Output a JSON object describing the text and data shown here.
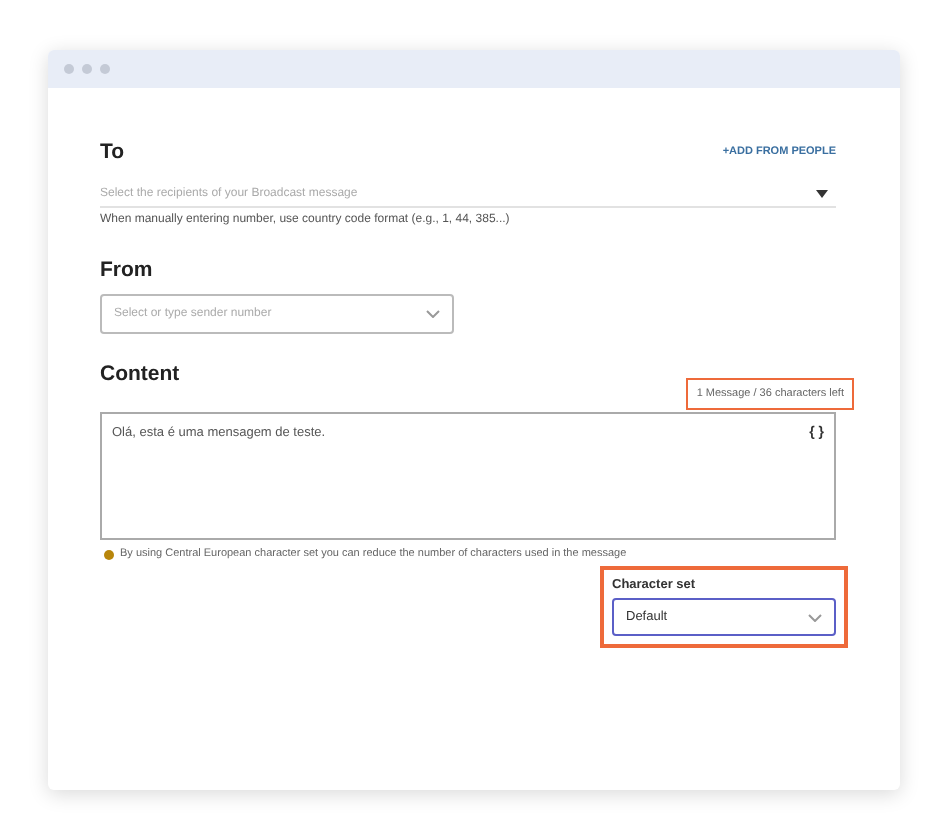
{
  "to": {
    "label": "To",
    "action": "+ADD FROM PEOPLE",
    "placeholder": "Select the recipients of your Broadcast message",
    "hint": "When manually entering number, use country code format (e.g., 1, 44, 385...)"
  },
  "from": {
    "label": "From",
    "placeholder": "Select or type sender number"
  },
  "content": {
    "label": "Content",
    "counter": {
      "text": "1 Message / 36 characters left",
      "highlighted": true
    },
    "value": "Olá, esta é uma mensagem de teste.",
    "variable_button": "{ }",
    "info": "By using Central European character set you can reduce the number of characters used in the message"
  },
  "character_set": {
    "label": "Character set",
    "value": "Default",
    "highlighted": true,
    "focused": true
  }
}
